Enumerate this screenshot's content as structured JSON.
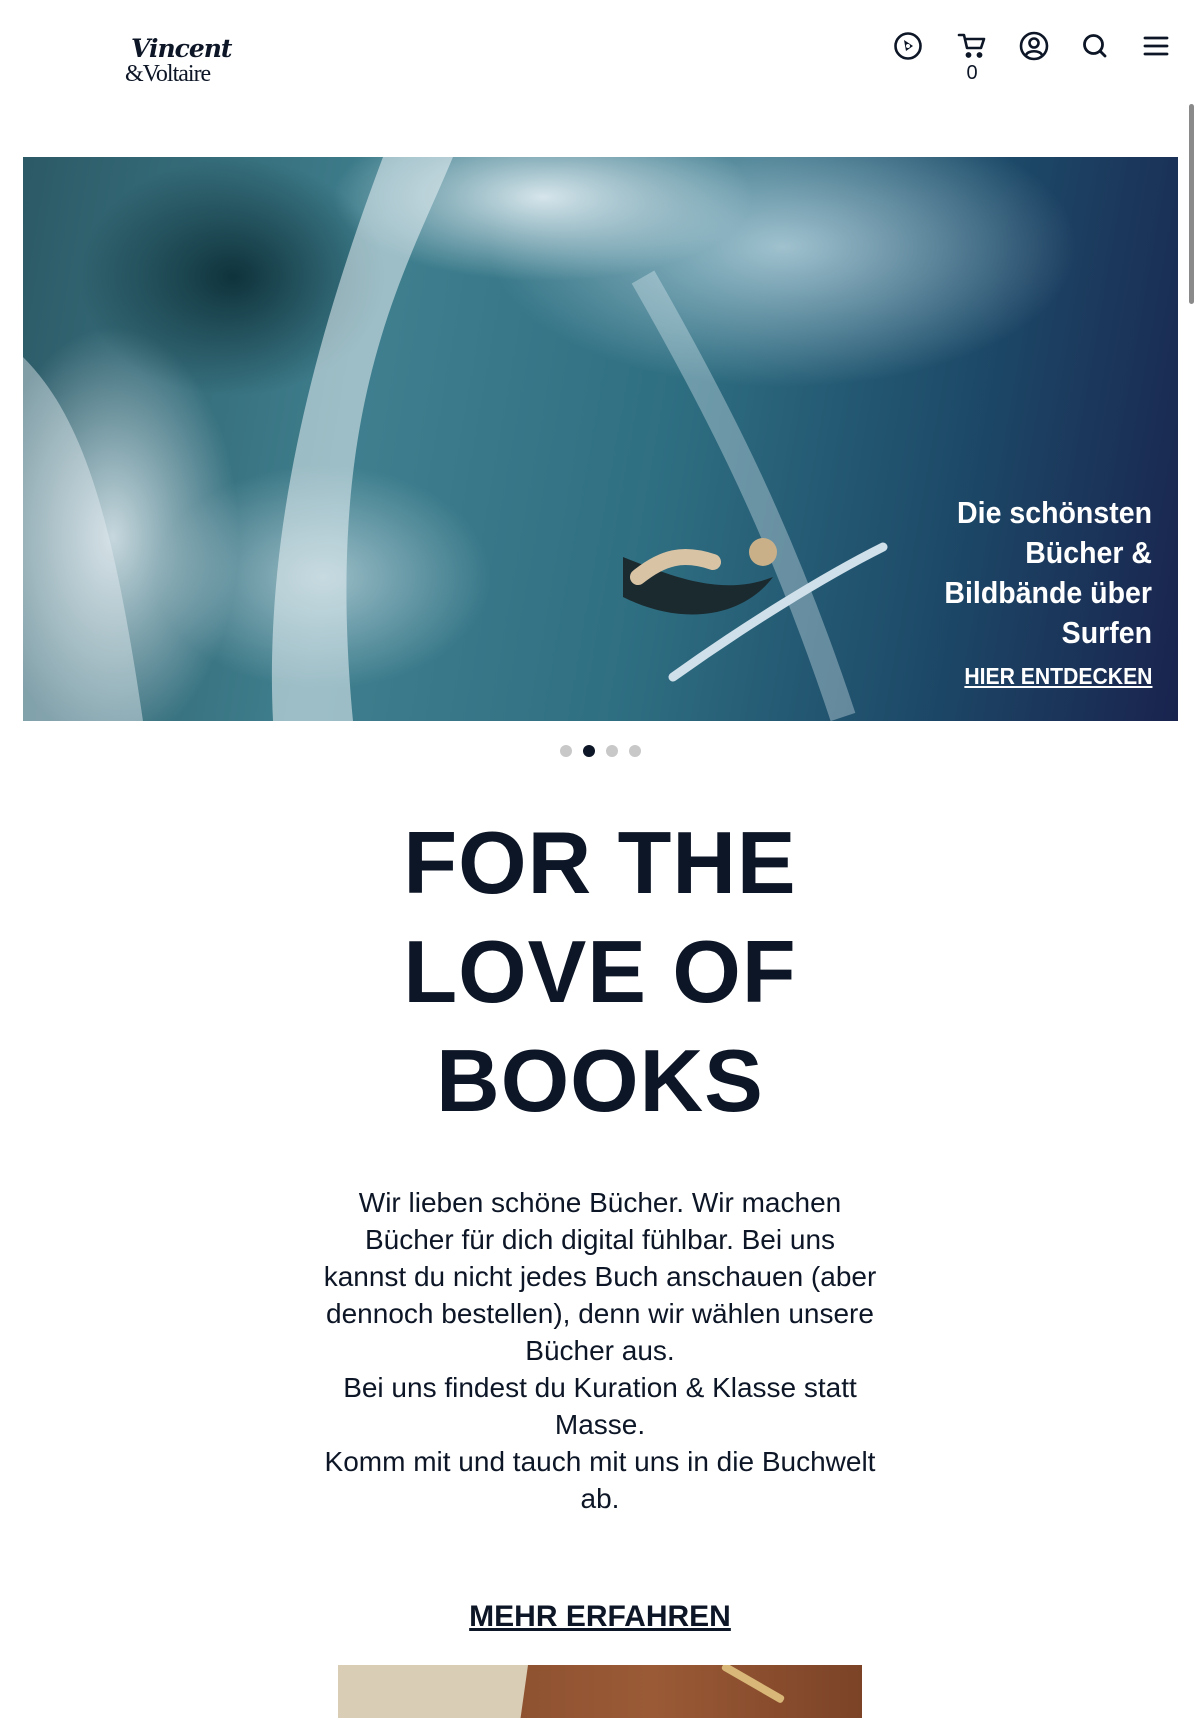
{
  "header": {
    "logo": {
      "line1": "Vincent",
      "line2": "&Voltaire"
    },
    "cart_count": "0",
    "icons": [
      "compass-icon",
      "cart-icon",
      "account-icon",
      "search-icon",
      "menu-icon"
    ]
  },
  "hero": {
    "title_lines": [
      "Die schönsten",
      "Bücher &",
      "Bildbände über",
      "Surfen"
    ],
    "link_label": "HIER ENTDECKEN",
    "slide_count": 4,
    "active_slide": 2
  },
  "main": {
    "headline_lines": [
      "FOR THE",
      "LOVE OF",
      "BOOKS"
    ],
    "intro_lines": [
      "Wir lieben schöne Bücher. Wir machen Bücher für dich digital fühlbar. Bei uns kannst du nicht jedes Buch anschauen (aber dennoch bestellen), denn wir wählen unsere Bücher aus.",
      "Bei uns findest du Kuration & Klasse statt Masse.",
      "Komm mit und tauch mit uns in die Buchwelt ab."
    ],
    "more_label": "MEHR ERFAHREN"
  },
  "colors": {
    "text": "#0d1626",
    "dot_inactive": "#c8c8c8",
    "dot_active": "#0d1626"
  }
}
